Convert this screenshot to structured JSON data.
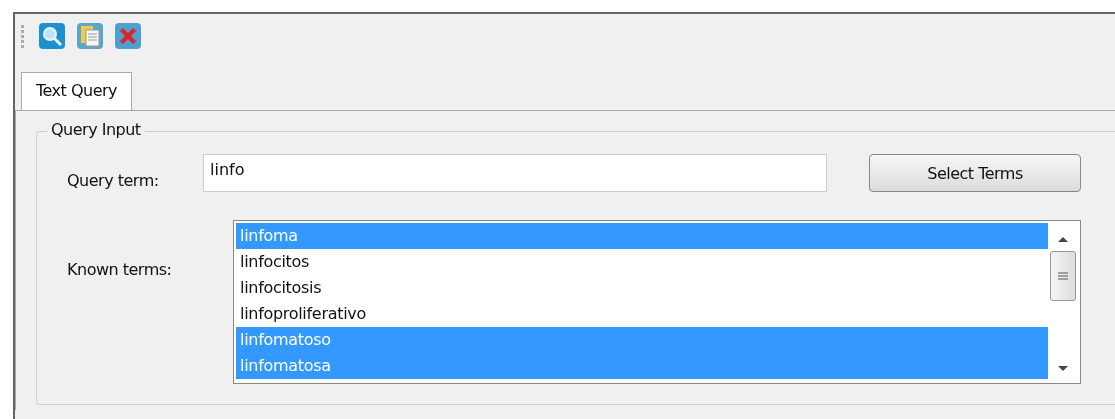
{
  "tabs": [
    {
      "label": "Text Query",
      "selected": true
    }
  ],
  "group": {
    "title": "Query Input",
    "query_term": {
      "label": "Query term:",
      "value": "linfo"
    },
    "button": "Select Terms",
    "known_terms": {
      "label": "Known terms:",
      "items": [
        {
          "text": "linfoma",
          "selected": true
        },
        {
          "text": "linfocitos",
          "selected": false
        },
        {
          "text": "linfocitosis",
          "selected": false
        },
        {
          "text": "linfoproliferativo",
          "selected": false
        },
        {
          "text": "linfomatoso",
          "selected": true
        },
        {
          "text": "linfomatosa",
          "selected": true
        }
      ]
    }
  }
}
